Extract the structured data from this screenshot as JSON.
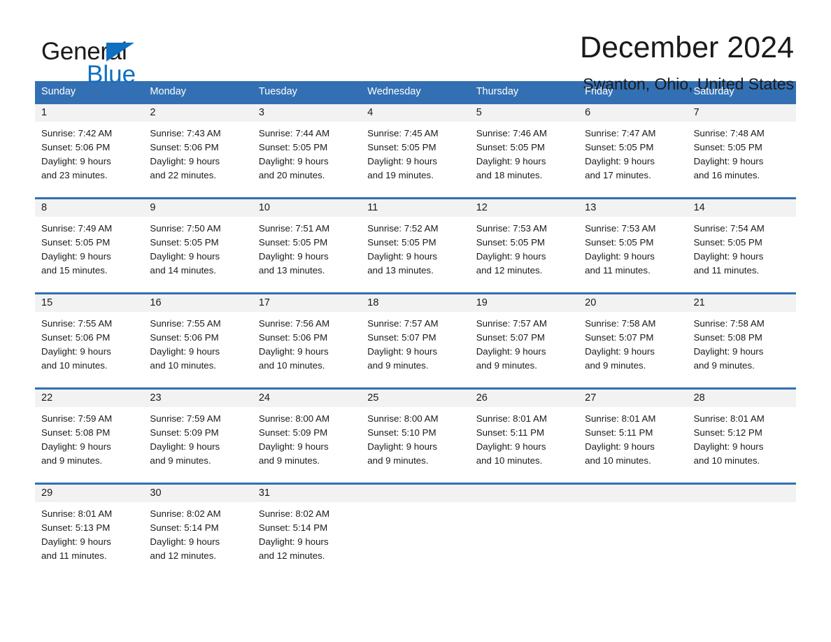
{
  "brand": {
    "name_part1": "General",
    "name_part2": "Blue",
    "accent_color": "#0f6fc0"
  },
  "header": {
    "title": "December 2024",
    "location": "Swanton, Ohio, United States"
  },
  "calendar": {
    "header_color": "#3370b3",
    "weekdays": [
      "Sunday",
      "Monday",
      "Tuesday",
      "Wednesday",
      "Thursday",
      "Friday",
      "Saturday"
    ],
    "weeks": [
      [
        {
          "day": "1",
          "sunrise": "Sunrise: 7:42 AM",
          "sunset": "Sunset: 5:06 PM",
          "daylight1": "Daylight: 9 hours",
          "daylight2": "and 23 minutes."
        },
        {
          "day": "2",
          "sunrise": "Sunrise: 7:43 AM",
          "sunset": "Sunset: 5:06 PM",
          "daylight1": "Daylight: 9 hours",
          "daylight2": "and 22 minutes."
        },
        {
          "day": "3",
          "sunrise": "Sunrise: 7:44 AM",
          "sunset": "Sunset: 5:05 PM",
          "daylight1": "Daylight: 9 hours",
          "daylight2": "and 20 minutes."
        },
        {
          "day": "4",
          "sunrise": "Sunrise: 7:45 AM",
          "sunset": "Sunset: 5:05 PM",
          "daylight1": "Daylight: 9 hours",
          "daylight2": "and 19 minutes."
        },
        {
          "day": "5",
          "sunrise": "Sunrise: 7:46 AM",
          "sunset": "Sunset: 5:05 PM",
          "daylight1": "Daylight: 9 hours",
          "daylight2": "and 18 minutes."
        },
        {
          "day": "6",
          "sunrise": "Sunrise: 7:47 AM",
          "sunset": "Sunset: 5:05 PM",
          "daylight1": "Daylight: 9 hours",
          "daylight2": "and 17 minutes."
        },
        {
          "day": "7",
          "sunrise": "Sunrise: 7:48 AM",
          "sunset": "Sunset: 5:05 PM",
          "daylight1": "Daylight: 9 hours",
          "daylight2": "and 16 minutes."
        }
      ],
      [
        {
          "day": "8",
          "sunrise": "Sunrise: 7:49 AM",
          "sunset": "Sunset: 5:05 PM",
          "daylight1": "Daylight: 9 hours",
          "daylight2": "and 15 minutes."
        },
        {
          "day": "9",
          "sunrise": "Sunrise: 7:50 AM",
          "sunset": "Sunset: 5:05 PM",
          "daylight1": "Daylight: 9 hours",
          "daylight2": "and 14 minutes."
        },
        {
          "day": "10",
          "sunrise": "Sunrise: 7:51 AM",
          "sunset": "Sunset: 5:05 PM",
          "daylight1": "Daylight: 9 hours",
          "daylight2": "and 13 minutes."
        },
        {
          "day": "11",
          "sunrise": "Sunrise: 7:52 AM",
          "sunset": "Sunset: 5:05 PM",
          "daylight1": "Daylight: 9 hours",
          "daylight2": "and 13 minutes."
        },
        {
          "day": "12",
          "sunrise": "Sunrise: 7:53 AM",
          "sunset": "Sunset: 5:05 PM",
          "daylight1": "Daylight: 9 hours",
          "daylight2": "and 12 minutes."
        },
        {
          "day": "13",
          "sunrise": "Sunrise: 7:53 AM",
          "sunset": "Sunset: 5:05 PM",
          "daylight1": "Daylight: 9 hours",
          "daylight2": "and 11 minutes."
        },
        {
          "day": "14",
          "sunrise": "Sunrise: 7:54 AM",
          "sunset": "Sunset: 5:05 PM",
          "daylight1": "Daylight: 9 hours",
          "daylight2": "and 11 minutes."
        }
      ],
      [
        {
          "day": "15",
          "sunrise": "Sunrise: 7:55 AM",
          "sunset": "Sunset: 5:06 PM",
          "daylight1": "Daylight: 9 hours",
          "daylight2": "and 10 minutes."
        },
        {
          "day": "16",
          "sunrise": "Sunrise: 7:55 AM",
          "sunset": "Sunset: 5:06 PM",
          "daylight1": "Daylight: 9 hours",
          "daylight2": "and 10 minutes."
        },
        {
          "day": "17",
          "sunrise": "Sunrise: 7:56 AM",
          "sunset": "Sunset: 5:06 PM",
          "daylight1": "Daylight: 9 hours",
          "daylight2": "and 10 minutes."
        },
        {
          "day": "18",
          "sunrise": "Sunrise: 7:57 AM",
          "sunset": "Sunset: 5:07 PM",
          "daylight1": "Daylight: 9 hours",
          "daylight2": "and 9 minutes."
        },
        {
          "day": "19",
          "sunrise": "Sunrise: 7:57 AM",
          "sunset": "Sunset: 5:07 PM",
          "daylight1": "Daylight: 9 hours",
          "daylight2": "and 9 minutes."
        },
        {
          "day": "20",
          "sunrise": "Sunrise: 7:58 AM",
          "sunset": "Sunset: 5:07 PM",
          "daylight1": "Daylight: 9 hours",
          "daylight2": "and 9 minutes."
        },
        {
          "day": "21",
          "sunrise": "Sunrise: 7:58 AM",
          "sunset": "Sunset: 5:08 PM",
          "daylight1": "Daylight: 9 hours",
          "daylight2": "and 9 minutes."
        }
      ],
      [
        {
          "day": "22",
          "sunrise": "Sunrise: 7:59 AM",
          "sunset": "Sunset: 5:08 PM",
          "daylight1": "Daylight: 9 hours",
          "daylight2": "and 9 minutes."
        },
        {
          "day": "23",
          "sunrise": "Sunrise: 7:59 AM",
          "sunset": "Sunset: 5:09 PM",
          "daylight1": "Daylight: 9 hours",
          "daylight2": "and 9 minutes."
        },
        {
          "day": "24",
          "sunrise": "Sunrise: 8:00 AM",
          "sunset": "Sunset: 5:09 PM",
          "daylight1": "Daylight: 9 hours",
          "daylight2": "and 9 minutes."
        },
        {
          "day": "25",
          "sunrise": "Sunrise: 8:00 AM",
          "sunset": "Sunset: 5:10 PM",
          "daylight1": "Daylight: 9 hours",
          "daylight2": "and 9 minutes."
        },
        {
          "day": "26",
          "sunrise": "Sunrise: 8:01 AM",
          "sunset": "Sunset: 5:11 PM",
          "daylight1": "Daylight: 9 hours",
          "daylight2": "and 10 minutes."
        },
        {
          "day": "27",
          "sunrise": "Sunrise: 8:01 AM",
          "sunset": "Sunset: 5:11 PM",
          "daylight1": "Daylight: 9 hours",
          "daylight2": "and 10 minutes."
        },
        {
          "day": "28",
          "sunrise": "Sunrise: 8:01 AM",
          "sunset": "Sunset: 5:12 PM",
          "daylight1": "Daylight: 9 hours",
          "daylight2": "and 10 minutes."
        }
      ],
      [
        {
          "day": "29",
          "sunrise": "Sunrise: 8:01 AM",
          "sunset": "Sunset: 5:13 PM",
          "daylight1": "Daylight: 9 hours",
          "daylight2": "and 11 minutes."
        },
        {
          "day": "30",
          "sunrise": "Sunrise: 8:02 AM",
          "sunset": "Sunset: 5:14 PM",
          "daylight1": "Daylight: 9 hours",
          "daylight2": "and 12 minutes."
        },
        {
          "day": "31",
          "sunrise": "Sunrise: 8:02 AM",
          "sunset": "Sunset: 5:14 PM",
          "daylight1": "Daylight: 9 hours",
          "daylight2": "and 12 minutes."
        },
        {
          "day": "",
          "sunrise": "",
          "sunset": "",
          "daylight1": "",
          "daylight2": ""
        },
        {
          "day": "",
          "sunrise": "",
          "sunset": "",
          "daylight1": "",
          "daylight2": ""
        },
        {
          "day": "",
          "sunrise": "",
          "sunset": "",
          "daylight1": "",
          "daylight2": ""
        },
        {
          "day": "",
          "sunrise": "",
          "sunset": "",
          "daylight1": "",
          "daylight2": ""
        }
      ]
    ]
  }
}
